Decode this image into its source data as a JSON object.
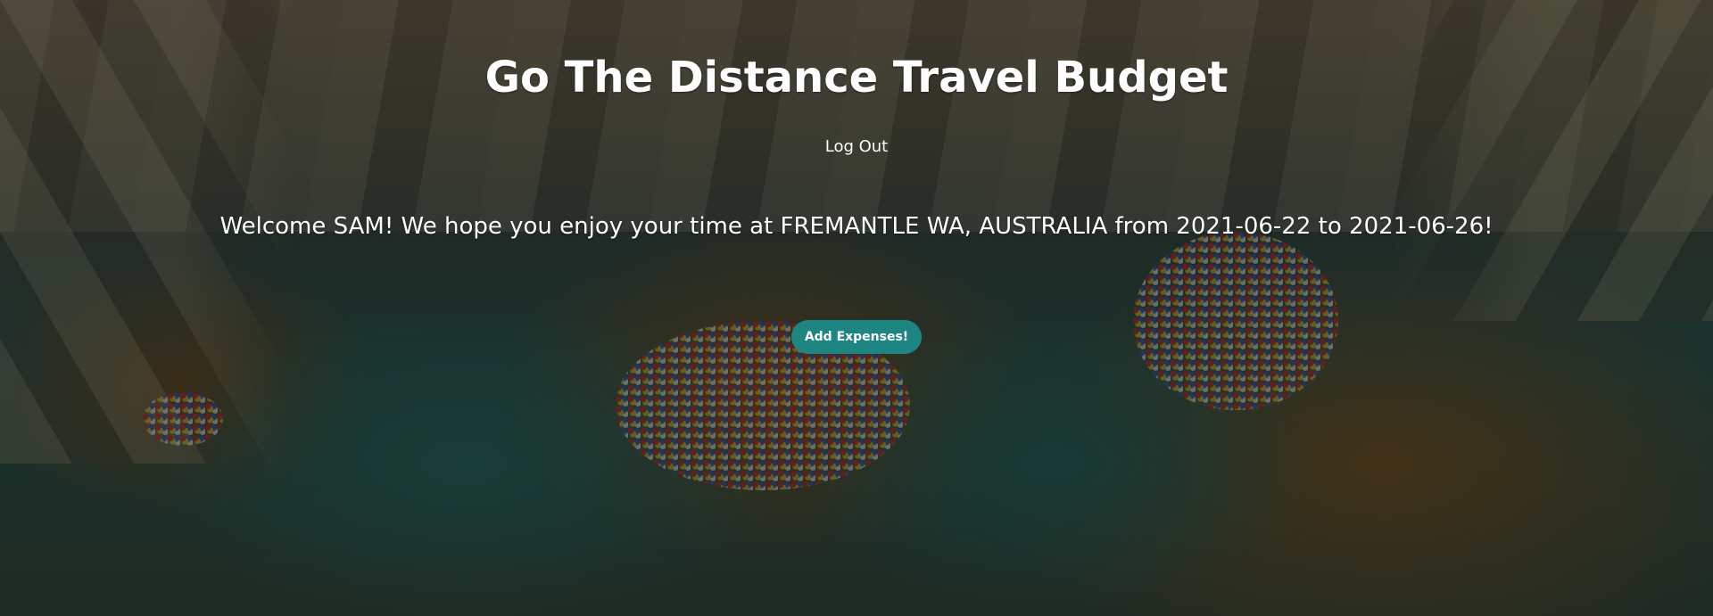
{
  "header": {
    "title": "Go The Distance Travel Budget",
    "logout_label": "Log Out"
  },
  "main": {
    "welcome_message": "Welcome SAM! We hope you enjoy your time at FREMANTLE WA, AUSTRALIA from 2021-06-22 to 2021-06-26!",
    "add_expenses_label": "Add Expenses!"
  },
  "colors": {
    "button_bg": "#1d8683",
    "text": "#ffffff",
    "overlay": "rgba(0,0,0,0.45)"
  },
  "background": {
    "description_icon": "world-map-money-pins-image"
  }
}
